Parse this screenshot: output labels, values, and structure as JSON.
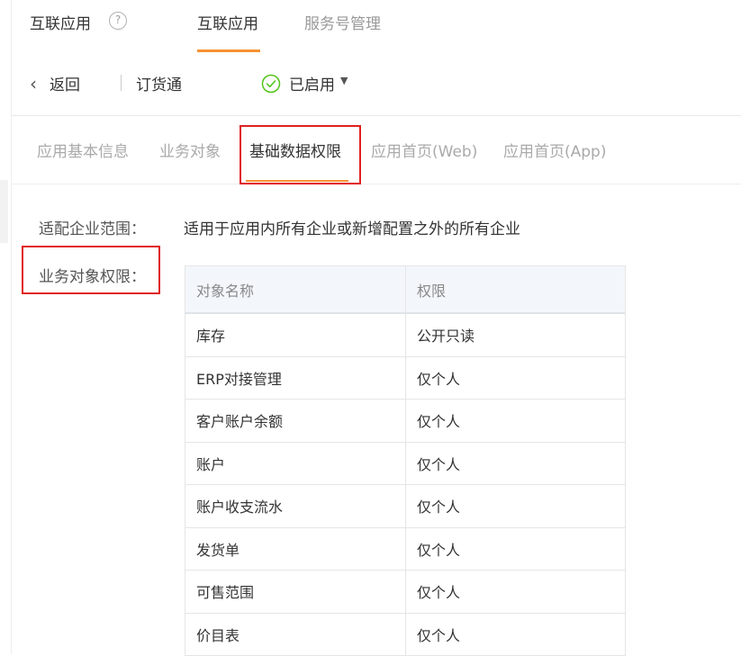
{
  "header": {
    "app_title": "互联应用",
    "help_icon_glyph": "?",
    "tabs": [
      {
        "label": "互联应用",
        "active": true
      },
      {
        "label": "服务号管理",
        "active": false
      }
    ],
    "accent_color": "#f79232"
  },
  "toolbar": {
    "back_label": "返回",
    "app_name": "订货通",
    "status_label": "已启用",
    "status_color": "#52c41a"
  },
  "sub_tabs": [
    {
      "label": "应用基本信息",
      "active": false
    },
    {
      "label": "业务对象",
      "active": false
    },
    {
      "label": "基础数据权限",
      "active": true
    },
    {
      "label": "应用首页(Web)",
      "active": false
    },
    {
      "label": "应用首页(App)",
      "active": false
    }
  ],
  "form": {
    "scope_label": "适配企业范围：",
    "scope_value": "适用于应用内所有企业或新增配置之外的所有企业",
    "permissions_label": "业务对象权限："
  },
  "table": {
    "headers": [
      "对象名称",
      "权限"
    ],
    "rows": [
      [
        "库存",
        "公开只读"
      ],
      [
        "ERP对接管理",
        "仅个人"
      ],
      [
        "客户账户余额",
        "仅个人"
      ],
      [
        "账户",
        "仅个人"
      ],
      [
        "账户收支流水",
        "仅个人"
      ],
      [
        "发货单",
        "仅个人"
      ],
      [
        "可售范围",
        "仅个人"
      ],
      [
        "价目表",
        "仅个人"
      ]
    ]
  }
}
